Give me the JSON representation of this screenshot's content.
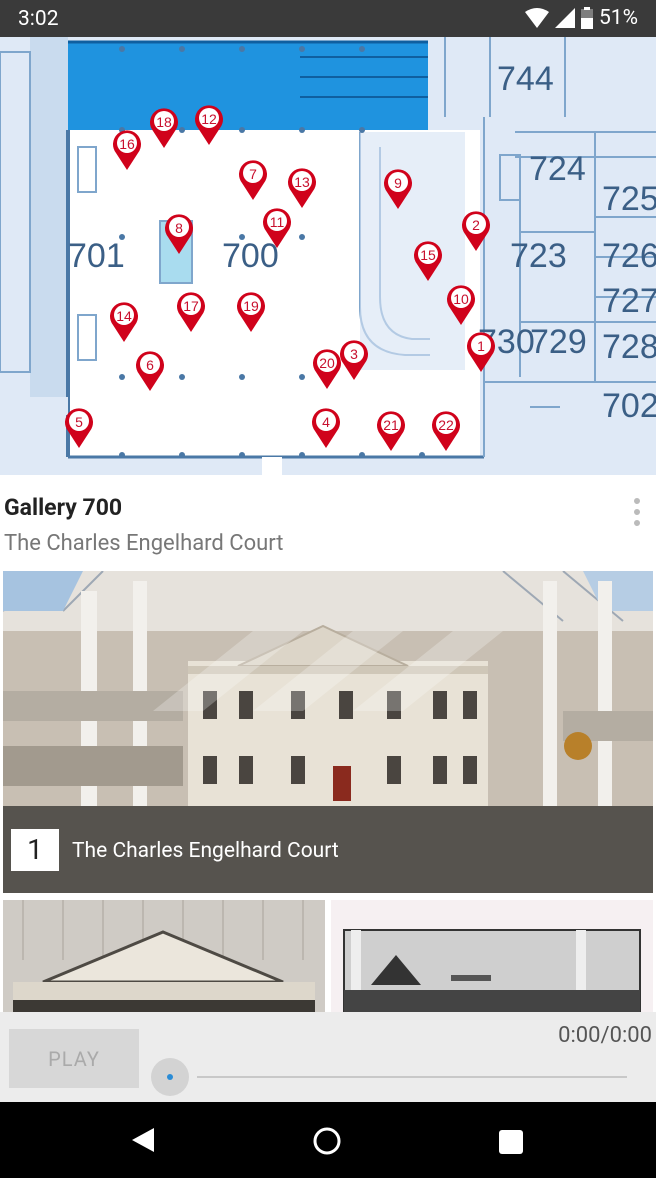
{
  "status_bar": {
    "time": "3:02",
    "battery": "51%",
    "icons": [
      "wifi-icon",
      "cell-signal-icon",
      "battery-icon"
    ]
  },
  "map": {
    "rooms": [
      {
        "id": "744",
        "label": "744"
      },
      {
        "id": "724",
        "label": "724"
      },
      {
        "id": "725",
        "label": "725"
      },
      {
        "id": "701",
        "label": "701"
      },
      {
        "id": "700",
        "label": "700"
      },
      {
        "id": "723",
        "label": "723"
      },
      {
        "id": "726",
        "label": "726"
      },
      {
        "id": "727",
        "label": "727"
      },
      {
        "id": "730",
        "label": "730"
      },
      {
        "id": "729",
        "label": "729"
      },
      {
        "id": "728",
        "label": "728"
      },
      {
        "id": "702",
        "label": "702"
      }
    ],
    "pins": [
      {
        "id": "1",
        "label": "1"
      },
      {
        "id": "2",
        "label": "2"
      },
      {
        "id": "3",
        "label": "3"
      },
      {
        "id": "4",
        "label": "4"
      },
      {
        "id": "5",
        "label": "5"
      },
      {
        "id": "6",
        "label": "6"
      },
      {
        "id": "7",
        "label": "7"
      },
      {
        "id": "8",
        "label": "8"
      },
      {
        "id": "9",
        "label": "9"
      },
      {
        "id": "10",
        "label": "10"
      },
      {
        "id": "11",
        "label": "11"
      },
      {
        "id": "12",
        "label": "12"
      },
      {
        "id": "13",
        "label": "13"
      },
      {
        "id": "14",
        "label": "14"
      },
      {
        "id": "15",
        "label": "15"
      },
      {
        "id": "16",
        "label": "16"
      },
      {
        "id": "17",
        "label": "17"
      },
      {
        "id": "18",
        "label": "18"
      },
      {
        "id": "19",
        "label": "19"
      },
      {
        "id": "20",
        "label": "20"
      },
      {
        "id": "21",
        "label": "21"
      },
      {
        "id": "22",
        "label": "22"
      }
    ],
    "pin_color": "#d0021b"
  },
  "gallery": {
    "title": "Gallery 700",
    "subtitle": "The Charles Engelhard Court"
  },
  "hero": {
    "number": "1",
    "caption": "The Charles Engelhard Court"
  },
  "player": {
    "play_label": "PLAY",
    "time": "0:00/0:00",
    "progress": 0
  },
  "nav": {
    "icons": [
      "back-icon",
      "home-icon",
      "recent-apps-icon"
    ]
  }
}
